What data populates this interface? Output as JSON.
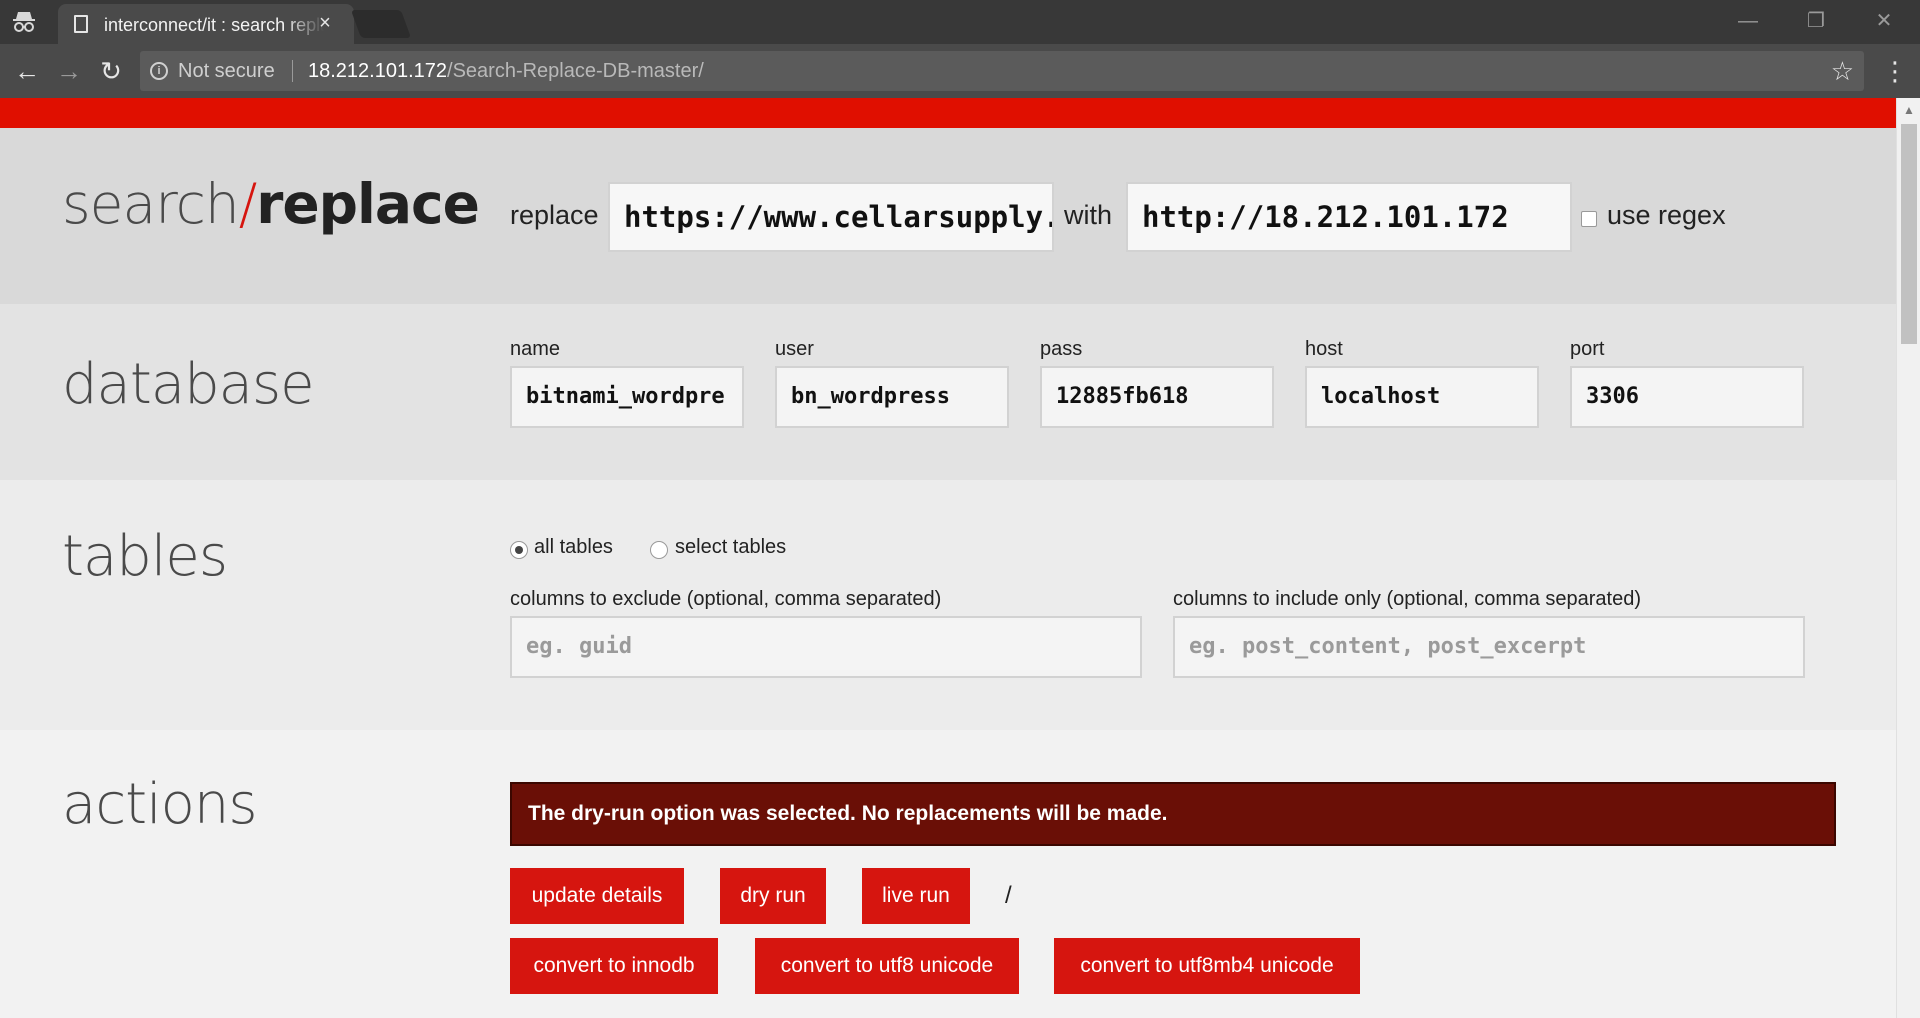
{
  "browser": {
    "tab_title": "interconnect/it : search replace",
    "tab_close": "×",
    "not_secure": "Not secure",
    "url_host": "18.212.101.172",
    "url_path": "/Search-Replace-DB-master/",
    "window_controls": {
      "minimize": "—",
      "restore": "❐",
      "close": "✕"
    },
    "icons": {
      "incognito": "incognito-icon",
      "doc": "document-icon",
      "back": "←",
      "forward": "→",
      "reload": "↻",
      "info": "i",
      "star": "☆",
      "menu": "⋮"
    }
  },
  "brand": {
    "search": "search",
    "slash": "/",
    "replace": "replace"
  },
  "search_replace": {
    "replace_label": "replace",
    "replace_value": "https://www.cellarsupply.",
    "with_label": "with",
    "with_value": "http://18.212.101.172",
    "regex_label": "use regex",
    "regex_checked": false
  },
  "database": {
    "title": "database",
    "fields": [
      {
        "label": "name",
        "value": "bitnami_wordpre"
      },
      {
        "label": "user",
        "value": "bn_wordpress"
      },
      {
        "label": "pass",
        "value": "12885fb618"
      },
      {
        "label": "host",
        "value": "localhost"
      },
      {
        "label": "port",
        "value": "3306"
      }
    ]
  },
  "tables": {
    "title": "tables",
    "all_tables": "all tables",
    "select_tables": "select tables",
    "selected": "all tables",
    "exclude_label": "columns to exclude (optional, comma separated)",
    "exclude_placeholder": "eg. guid",
    "include_label": "columns to include only (optional, comma separated)",
    "include_placeholder": "eg. post_content, post_excerpt"
  },
  "actions": {
    "title": "actions",
    "notice": "The dry-run option was selected. No replacements will be made.",
    "update_details": "update details",
    "dry_run": "dry run",
    "live_run": "live run",
    "separator": "/",
    "convert_innodb": "convert to innodb",
    "convert_utf8": "convert to utf8 unicode",
    "convert_utf8mb4": "convert to utf8mb4 unicode"
  },
  "colors": {
    "brand_red": "#e00f00",
    "button_red": "#d6150f",
    "notice_bg": "#6a0f06"
  }
}
